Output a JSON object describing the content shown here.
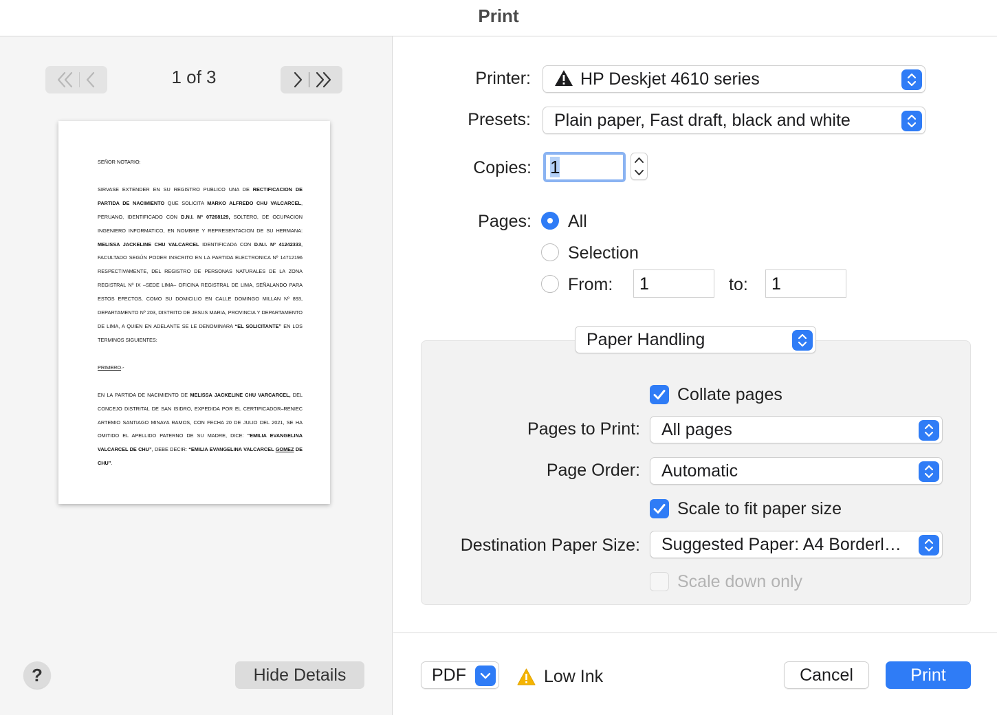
{
  "window": {
    "title": "Print"
  },
  "preview": {
    "page_indicator": "1 of 3",
    "document": {
      "p1": "SEÑOR NOTARIO:",
      "p2_a": "SIRVASE EXTENDER EN SU REGISTRO PUBLICO UNA DE ",
      "p2_b": "RECTIFICACION DE PARTIDA DE NACIMIENTO",
      "p2_c": " QUE SOLICITA ",
      "p2_d": "MARKO ALFREDO CHU VALCARCEL",
      "p2_e": ", PERUANO, IDENTIFICADO CON ",
      "p2_f": "D.N.I. Nº 07268129,",
      "p2_g": " SOLTERO, DE OCUPACION INGENIERO INFORMATICO, EN NOMBRE Y REPRESENTACION DE SU HERMANA: ",
      "p2_h": "MELISSA JACKELINE CHU VALCARCEL",
      "p2_i": " IDENTIFICADA CON ",
      "p2_j": "D.N.I. Nº 41242333",
      "p2_k": ", FACULTADO SEGÚN PODER INSCRITO EN LA PARTIDA ELECTRONICA Nº 14712196 RESPECTIVAMENTE, DEL REGISTRO DE PERSONAS NATURALES DE LA ZONA REGISTRAL Nº IX –SEDE LIMA– OFICINA REGISTRAL DE LIMA, SEÑALANDO PARA ESTOS EFECTOS, COMO SU DOMICILIO EN CALLE DOMINGO MILLAN Nº 893, DEPARTAMENTO Nº 203, DISTRITO DE JESUS MARIA, PROVINCIA Y DEPARTAMENTO DE LIMA, A QUIEN EN ADELANTE SE LE DENOMINARA ",
      "p2_l": "“EL SOLICITANTE”",
      "p2_m": " EN LOS TERMINOS SIGUIENTES:",
      "p3": "PRIMERO",
      "p3_suffix": ".-",
      "p4_a": "EN LA PARTIDA DE NACIMIENTO DE ",
      "p4_b": "MELISSA JACKELINE CHU VARCARCEL,",
      "p4_c": " DEL CONCEJO DISTRITAL DE SAN ISIDRO, EXPEDIDA POR EL CERTIFICADOR–RENIEC ARTEMIO SANTIAGO MINAYA RAMOS, CON FECHA 20 DE JULIO DEL 2021, SE HA OMITIDO EL APELLIDO PATERNO DE SU MADRE, DICE: ",
      "p4_d": "“EMILIA EVANGELINA VALCARCEL DE CHU”",
      "p4_e": ", DEBE DECIR: ",
      "p4_f": "“EMILIA EVANGELINA VALCARCEL ",
      "p4_g": "GOMEZ",
      "p4_h": " DE CHU”",
      "p4_i": "."
    }
  },
  "left_footer": {
    "help_label": "?",
    "hide_details_label": "Hide Details"
  },
  "form": {
    "printer_label": "Printer:",
    "printer_value": "HP Deskjet 4610 series",
    "presets_label": "Presets:",
    "presets_value": "Plain paper, Fast draft, black and white",
    "copies_label": "Copies:",
    "copies_value": "1",
    "pages_label": "Pages:",
    "pages_options": {
      "all": "All",
      "selection": "Selection",
      "from": "From:"
    },
    "pages_selected": "All",
    "from_value": "1",
    "to_label": "to:",
    "to_value": "1"
  },
  "section": {
    "selector_value": "Paper Handling",
    "collate_label": "Collate pages",
    "collate_checked": true,
    "pages_to_print_label": "Pages to Print:",
    "pages_to_print_value": "All pages",
    "page_order_label": "Page Order:",
    "page_order_value": "Automatic",
    "scale_fit_label": "Scale to fit paper size",
    "scale_fit_checked": true,
    "dest_size_label": "Destination Paper Size:",
    "dest_size_value": "Suggested Paper: A4 Borderl…",
    "scale_down_label": "Scale down only",
    "scale_down_checked": false
  },
  "footer": {
    "pdf_label": "PDF",
    "status_text": "Low Ink",
    "cancel_label": "Cancel",
    "print_label": "Print"
  },
  "colors": {
    "accent": "#2f7cf6",
    "warning": "#f5b400"
  },
  "icons": {
    "first_page": "double-chevron-left-icon",
    "prev_page": "chevron-left-icon",
    "next_page": "chevron-right-icon",
    "last_page": "double-chevron-right-icon",
    "printer_warning": "warning-triangle-icon",
    "low_ink": "warning-yellow-icon",
    "popup_arrows": "up-down-chevron-icon",
    "pdf_menu": "chevron-down-icon",
    "checkbox": "checkmark-icon"
  }
}
